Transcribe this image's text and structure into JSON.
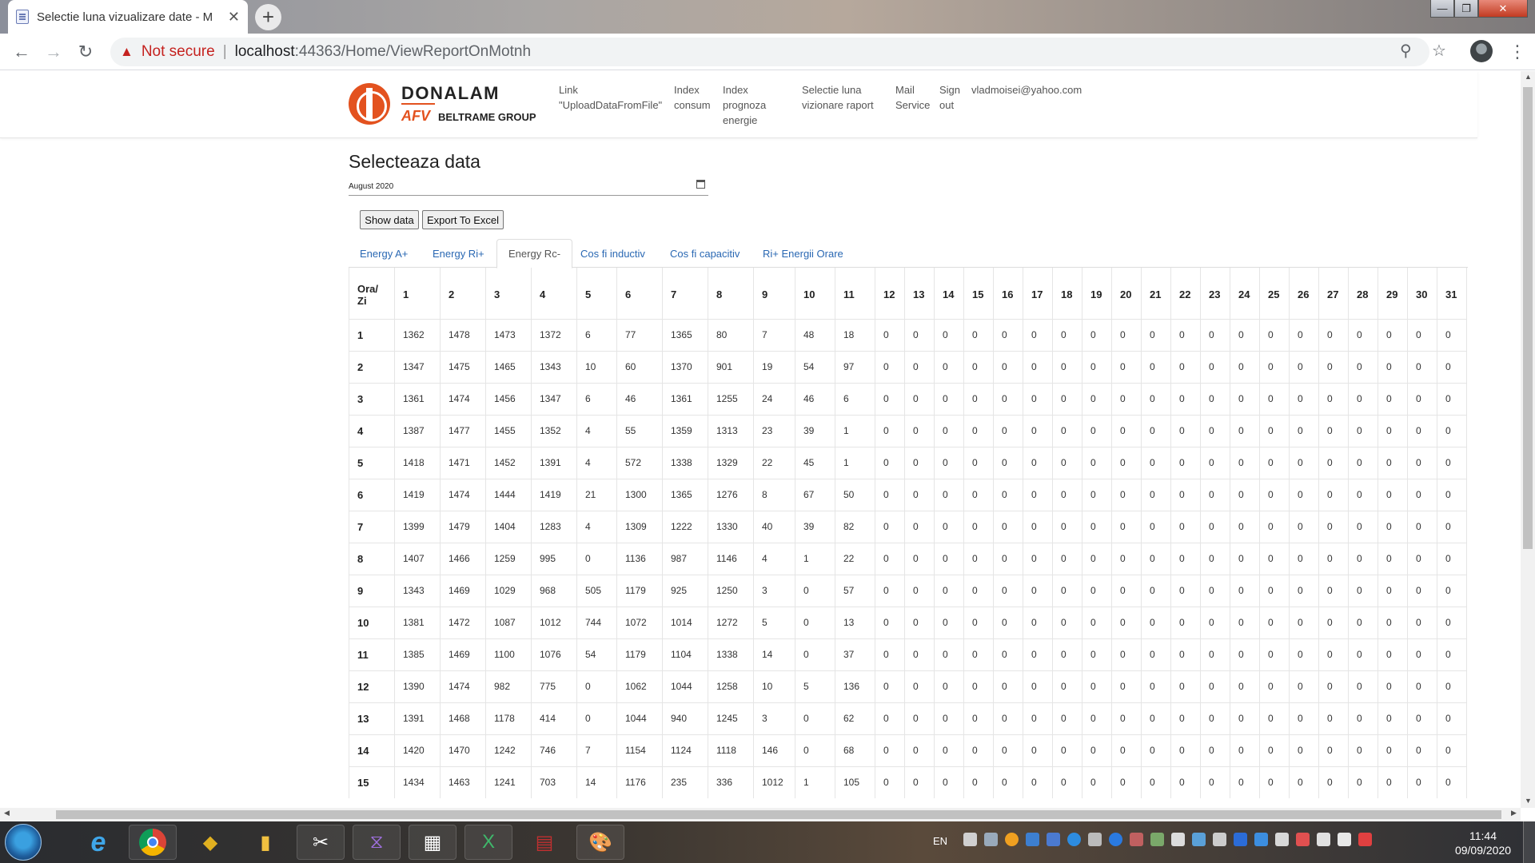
{
  "browser": {
    "tab_title": "Selectie luna vizualizare date - M",
    "new_tab": "+",
    "security_label": "Not secure",
    "url_host": "localhost",
    "url_path": ":44363/Home/ViewReportOnMotnh"
  },
  "navbar": {
    "brand_name": "DONALAM",
    "brand_afv": "AFV",
    "brand_group": "BELTRAME GROUP",
    "links": [
      {
        "line1": "Link",
        "line2": "\"UploadDataFromFile\"",
        "line3": ""
      },
      {
        "line1": "Index",
        "line2": "consum",
        "line3": ""
      },
      {
        "line1": "Index",
        "line2": "prognoza",
        "line3": "energie"
      },
      {
        "line1": "Selectie luna",
        "line2": "vizionare raport",
        "line3": ""
      },
      {
        "line1": "Mail",
        "line2": "Service",
        "line3": ""
      },
      {
        "line1": "Sign",
        "line2": "out",
        "line3": ""
      },
      {
        "line1": "vladmoisei@yahoo.com",
        "line2": "",
        "line3": ""
      }
    ]
  },
  "main": {
    "title": "Selecteaza data",
    "date_value": "August 2020",
    "show_button": "Show data",
    "export_button": "Export To Excel",
    "tabs": [
      {
        "label": "Energy A+"
      },
      {
        "label": "Energy Ri+"
      },
      {
        "label": "Energy Rc-",
        "active": true
      },
      {
        "label": "Cos fi inductiv"
      },
      {
        "label": "Cos fi capacitiv"
      },
      {
        "label": "Ri+ Energii Orare"
      }
    ]
  },
  "table": {
    "corner_line1": "Ora/",
    "corner_line2": "Zi",
    "columns": [
      "1",
      "2",
      "3",
      "4",
      "5",
      "6",
      "7",
      "8",
      "9",
      "10",
      "11",
      "12",
      "13",
      "14",
      "15",
      "16",
      "17",
      "18",
      "19",
      "20",
      "21",
      "22",
      "23",
      "24",
      "25",
      "26",
      "27",
      "28",
      "29",
      "30",
      "31"
    ],
    "rows": [
      {
        "hour": "1",
        "values": [
          "1362",
          "1478",
          "1473",
          "1372",
          "6",
          "77",
          "1365",
          "80",
          "7",
          "48",
          "18"
        ]
      },
      {
        "hour": "2",
        "values": [
          "1347",
          "1475",
          "1465",
          "1343",
          "10",
          "60",
          "1370",
          "901",
          "19",
          "54",
          "97"
        ]
      },
      {
        "hour": "3",
        "values": [
          "1361",
          "1474",
          "1456",
          "1347",
          "6",
          "46",
          "1361",
          "1255",
          "24",
          "46",
          "6"
        ]
      },
      {
        "hour": "4",
        "values": [
          "1387",
          "1477",
          "1455",
          "1352",
          "4",
          "55",
          "1359",
          "1313",
          "23",
          "39",
          "1"
        ]
      },
      {
        "hour": "5",
        "values": [
          "1418",
          "1471",
          "1452",
          "1391",
          "4",
          "572",
          "1338",
          "1329",
          "22",
          "45",
          "1"
        ]
      },
      {
        "hour": "6",
        "values": [
          "1419",
          "1474",
          "1444",
          "1419",
          "21",
          "1300",
          "1365",
          "1276",
          "8",
          "67",
          "50"
        ]
      },
      {
        "hour": "7",
        "values": [
          "1399",
          "1479",
          "1404",
          "1283",
          "4",
          "1309",
          "1222",
          "1330",
          "40",
          "39",
          "82"
        ]
      },
      {
        "hour": "8",
        "values": [
          "1407",
          "1466",
          "1259",
          "995",
          "0",
          "1136",
          "987",
          "1146",
          "4",
          "1",
          "22"
        ]
      },
      {
        "hour": "9",
        "values": [
          "1343",
          "1469",
          "1029",
          "968",
          "505",
          "1179",
          "925",
          "1250",
          "3",
          "0",
          "57"
        ]
      },
      {
        "hour": "10",
        "values": [
          "1381",
          "1472",
          "1087",
          "1012",
          "744",
          "1072",
          "1014",
          "1272",
          "5",
          "0",
          "13"
        ]
      },
      {
        "hour": "11",
        "values": [
          "1385",
          "1469",
          "1100",
          "1076",
          "54",
          "1179",
          "1104",
          "1338",
          "14",
          "0",
          "37"
        ]
      },
      {
        "hour": "12",
        "values": [
          "1390",
          "1474",
          "982",
          "775",
          "0",
          "1062",
          "1044",
          "1258",
          "10",
          "5",
          "136"
        ]
      },
      {
        "hour": "13",
        "values": [
          "1391",
          "1468",
          "1178",
          "414",
          "0",
          "1044",
          "940",
          "1245",
          "3",
          "0",
          "62"
        ]
      },
      {
        "hour": "14",
        "values": [
          "1420",
          "1470",
          "1242",
          "746",
          "7",
          "1154",
          "1124",
          "1118",
          "146",
          "0",
          "68"
        ]
      },
      {
        "hour": "15",
        "values": [
          "1434",
          "1463",
          "1241",
          "703",
          "14",
          "1176",
          "235",
          "336",
          "1012",
          "1",
          "105"
        ]
      }
    ],
    "zero_fill": "0"
  },
  "taskbar": {
    "lang": "EN",
    "time": "11:44",
    "date": "09/09/2020"
  }
}
